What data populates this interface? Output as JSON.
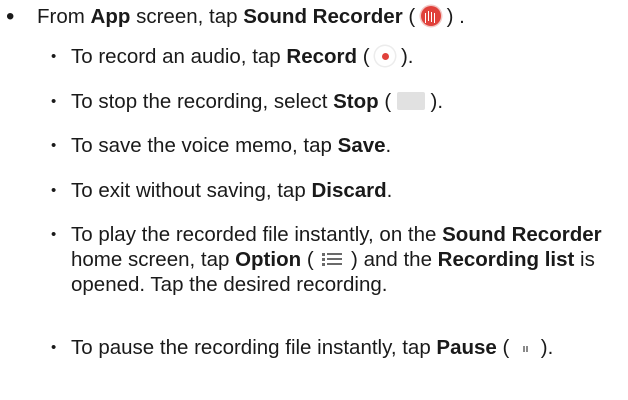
{
  "main_step": {
    "bullet": "•",
    "t1": "From ",
    "b1": "App",
    "t2": " screen, tap ",
    "b2": "Sound Recorder",
    "t3": " ( ",
    "icon": "sound-recorder-icon",
    "t4": " ) ."
  },
  "sub_steps": [
    {
      "bullet": "•",
      "t1": "To record an audio, tap ",
      "b1": "Record",
      "t2": " ( ",
      "icon": "record-icon",
      "t3": " )."
    },
    {
      "bullet": "•",
      "t1": "To stop the recording, select ",
      "b1": "Stop",
      "t2": " ( ",
      "icon": "stop-icon",
      "t3": " )."
    },
    {
      "bullet": "•",
      "t1": "To save the voice memo, tap ",
      "b1": "Save",
      "t2": "."
    },
    {
      "bullet": "•",
      "t1": "To exit without saving, tap ",
      "b1": "Discard",
      "t2": "."
    },
    {
      "bullet": "•",
      "t1": "To play the recorded file instantly, on the ",
      "b1": "Sound Recorder",
      "t2": " home screen, tap ",
      "b2": "Option",
      "t3": " ( ",
      "icon": "options-list-icon",
      "t4": " ) and the ",
      "b3": "Recording list",
      "t5": " is opened. Tap the desired recording."
    },
    {
      "bullet": "•",
      "t1": "To pause the recording file instantly, tap ",
      "b1": "Pause",
      "t2": " ( ",
      "icon": "pause-icon",
      "t3": " )."
    }
  ]
}
